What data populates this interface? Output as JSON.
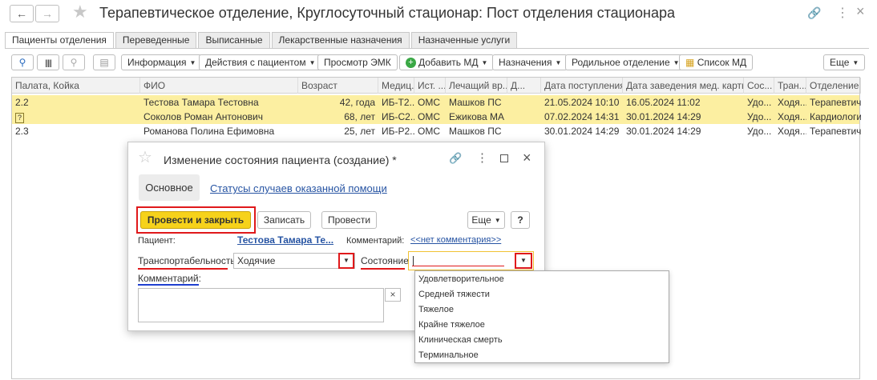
{
  "window": {
    "title": "Терапевтическое отделение, Круглосуточный стационар: Пост отделения стационара"
  },
  "icons": [
    "arrow-left-icon",
    "arrow-right-icon",
    "star-icon",
    "link-icon",
    "more-vert-icon",
    "close-icon"
  ],
  "tabs": [
    "Пациенты отделения",
    "Переведенные",
    "Выписанные",
    "Лекарственные назначения",
    "Назначенные услуги"
  ],
  "toolbar": {
    "info": "Информация",
    "actions": "Действия с пациентом",
    "emk": "Просмотр ЭМК",
    "add_md": "Добавить МД",
    "appointments": "Назначения",
    "maternity": "Родильное отделение",
    "md_list": "Список МД",
    "more": "Еще"
  },
  "table": {
    "columns": [
      "Палата, Койка",
      "ФИО",
      "Возраст",
      "Медиц...",
      "Ист. ...",
      "Лечащий вр...",
      "Д...",
      "Дата поступления",
      "Дата заведения мед. карты",
      "Сос...",
      "Тран...",
      "Отделение"
    ],
    "rows": [
      {
        "bed": "2.2",
        "name": "Тестова Тамара Тестовна",
        "age": "42,",
        "age_unit": "года",
        "card": "ИБ-Т2...",
        "source": "ОМС",
        "doctor": "Машков ПС",
        "admitted": "21.05.2024 10:10",
        "card_date": "16.05.2024 11:02",
        "state": "Удо...",
        "transport": "Ходя...",
        "department": "Терапевтич..."
      },
      {
        "bed": "",
        "name": "Соколов Роман Антонович",
        "age": "68,",
        "age_unit": "лет",
        "card": "ИБ-С2...",
        "source": "ОМС",
        "doctor": "Ежикова МА",
        "admitted": "07.02.2024 14:31",
        "card_date": "30.01.2024 14:29",
        "state": "Удо...",
        "transport": "Ходя...",
        "department": "Кардиологи..."
      },
      {
        "bed": "2.3",
        "name": "Романова Полина Ефимовна",
        "age": "25,",
        "age_unit": "лет",
        "card": "ИБ-Р2...",
        "source": "ОМС",
        "doctor": "Машков ПС",
        "admitted": "30.01.2024 14:29",
        "card_date": "30.01.2024 14:29",
        "state": "Удо...",
        "transport": "Ходя...",
        "department": "Терапевтич..."
      }
    ]
  },
  "dialog": {
    "title": "Изменение состояния пациента (создание) *",
    "tab_main": "Основное",
    "tab_statuses": "Статусы случаев оказанной помощи",
    "btn_post_close": "Провести и закрыть",
    "btn_save": "Записать",
    "btn_post": "Провести",
    "btn_more": "Еще",
    "btn_help": "?",
    "patient_label": "Пациент:",
    "patient_value": "Тестова Тамара Те...",
    "comment_label": "Комментарий:",
    "comment_value": "<<нет комментария>>",
    "transport_label": "Транспортабельность:",
    "transport_value": "Ходячие",
    "state_label": "Состояние:",
    "state_value": "",
    "comment2_label": "Комментарий:",
    "clear_icon": "×"
  },
  "dropdown": {
    "options": [
      "Удовлетворительное",
      "Средней тяжести",
      "Тяжелое",
      "Крайне тяжелое",
      "Клиническая смерть",
      "Терминальное"
    ]
  },
  "colors": {
    "highlight_row": "#fcefa1",
    "primary_button": "#f6d21b",
    "annotation_red": "#e0191b",
    "annotation_blue": "#1f3fd0",
    "link": "#2754a3"
  }
}
